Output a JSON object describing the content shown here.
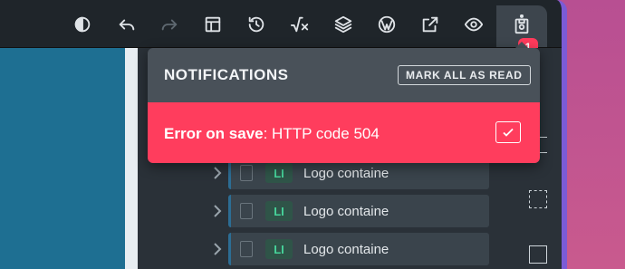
{
  "toolbar": {
    "icons": [
      "theme-icon",
      "undo-icon",
      "redo-icon",
      "layout-icon",
      "history-icon",
      "math-icon",
      "layers-icon",
      "wordpress-icon",
      "external-link-icon",
      "preview-icon",
      "save-icon"
    ],
    "notification_count": "1"
  },
  "notifications": {
    "title": "NOTIFICATIONS",
    "mark_all_label": "MARK ALL AS READ",
    "items": [
      {
        "strong": "Error on save",
        "text": ": HTTP code 504",
        "color": "#ff3d5d"
      }
    ]
  },
  "tree": {
    "rows": [
      {
        "tag": "LI",
        "label": "Logo containe"
      },
      {
        "tag": "LI",
        "label": "Logo containe"
      },
      {
        "tag": "LI",
        "label": "Logo containe"
      }
    ]
  },
  "colors": {
    "canvas": "#1e6f92",
    "accent": "#ff3d5d",
    "tag": "#46d39a"
  }
}
